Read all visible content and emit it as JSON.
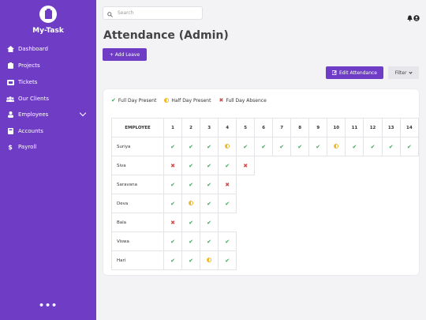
{
  "app": {
    "brand": "My-Task",
    "more_label": "•••"
  },
  "sidebar": {
    "items": [
      {
        "label": "Dashboard"
      },
      {
        "label": "Projects"
      },
      {
        "label": "Tickets"
      },
      {
        "label": "Our Clients"
      },
      {
        "label": "Employees"
      },
      {
        "label": "Accounts"
      },
      {
        "label": "Payroll"
      }
    ]
  },
  "header": {
    "search_placeholder": "Search"
  },
  "page": {
    "title": "Attendance (Admin)",
    "add_leave_label": "+ Add Leave",
    "edit_attendance_label": "Edit Attendance",
    "filter_label": "Filter"
  },
  "legend": {
    "present": "Full Day Present",
    "half": "Half Day Present",
    "absent": "Full Day Absence"
  },
  "table": {
    "employee_header": "EMPLOYEE",
    "days": [
      "1",
      "2",
      "3",
      "4",
      "5",
      "6",
      "7",
      "8",
      "9",
      "10",
      "11",
      "12",
      "13",
      "14"
    ],
    "rows": [
      {
        "name": "Suriya",
        "cells": [
          "P",
          "P",
          "P",
          "H",
          "P",
          "P",
          "P",
          "P",
          "P",
          "H",
          "P",
          "P",
          "P",
          "P"
        ]
      },
      {
        "name": "Siva",
        "cells": [
          "A",
          "P",
          "P",
          "P",
          "A"
        ]
      },
      {
        "name": "Saravana",
        "cells": [
          "P",
          "P",
          "P",
          "A"
        ]
      },
      {
        "name": "Deva",
        "cells": [
          "P",
          "H",
          "P",
          "P"
        ]
      },
      {
        "name": "Bala",
        "cells": [
          "A",
          "P",
          "P"
        ]
      },
      {
        "name": "Viswa",
        "cells": [
          "P",
          "P",
          "P",
          "P"
        ]
      },
      {
        "name": "Hari",
        "cells": [
          "P",
          "P",
          "H",
          "P"
        ]
      }
    ]
  },
  "colors": {
    "accent": "#6f3cc6",
    "present": "#3aa85a",
    "half": "#f0b928",
    "absent": "#d94848"
  }
}
